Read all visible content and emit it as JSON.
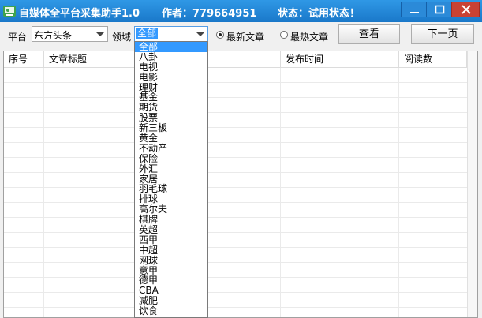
{
  "titlebar": {
    "app_name": "自媒体全平台采集助手1.0",
    "author": "作者：779664951",
    "status": "状态：试用状态！"
  },
  "toolbar": {
    "platform_label": "平台",
    "platform_value": "东方头条",
    "domain_label": "领域",
    "domain_value": "全部",
    "radio_latest": "最新文章",
    "radio_hot": "最热文章",
    "query_button": "查看",
    "next_button": "下一页"
  },
  "table": {
    "columns": [
      "序号",
      "文章标题",
      "发布时间",
      "阅读数"
    ]
  },
  "dropdown": {
    "options": [
      "全部",
      "八卦",
      "电视",
      "电影",
      "理财",
      "基金",
      "期货",
      "股票",
      "新三板",
      "黄金",
      "不动产",
      "保险",
      "外汇",
      "家居",
      "羽毛球",
      "排球",
      "高尔夫",
      "棋牌",
      "英超",
      "西甲",
      "中超",
      "网球",
      "意甲",
      "德甲",
      "CBA",
      "减肥",
      "饮食"
    ]
  },
  "colors": {
    "titlebar": "#1f82d2",
    "selection": "#3399ff",
    "close_button": "#c94234"
  }
}
